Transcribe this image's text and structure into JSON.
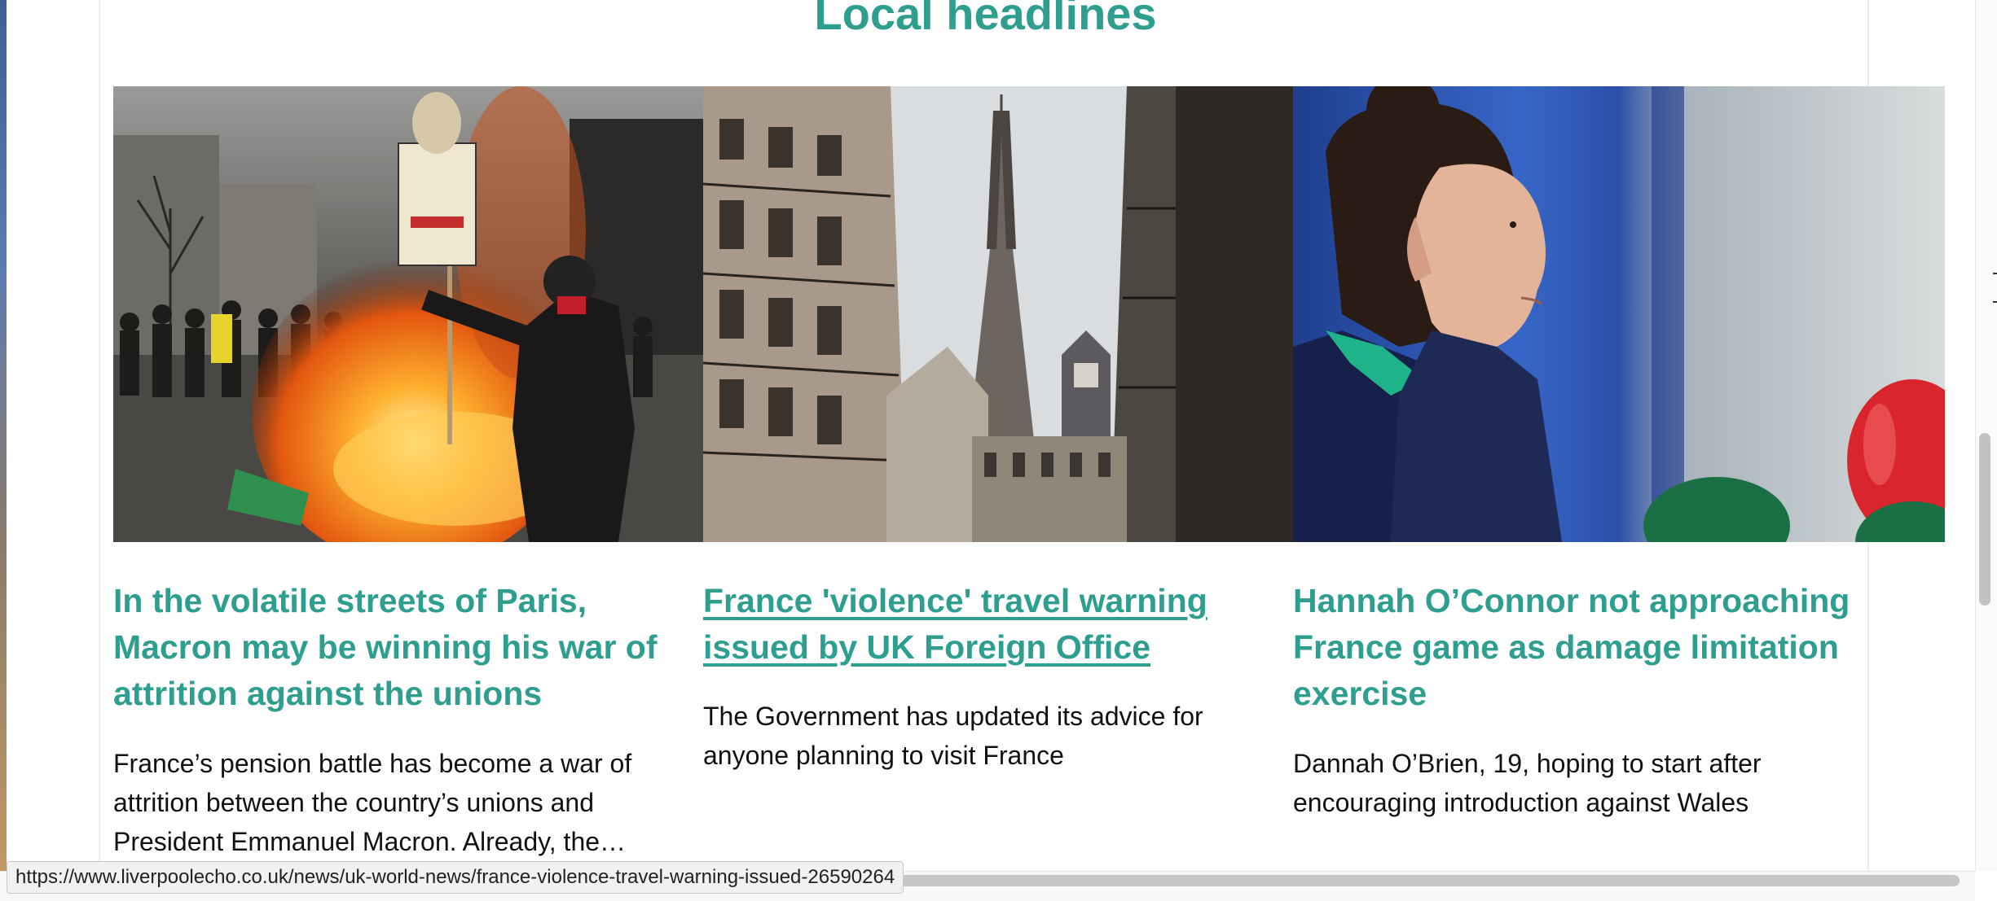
{
  "section": {
    "title": "Local headlines"
  },
  "cards": [
    {
      "image": "Protesters near a burning street fire in Paris, one holding a Macron placard",
      "headline": "In the volatile streets of Paris, Macron may be winning his war of attrition against the unions",
      "summary": "France’s pension battle has become a war of attrition between the country’s unions and President Emmanuel Macron. Already, the…"
    },
    {
      "image": "Parisian street view with Haussmann buildings and the Eiffel Tower",
      "headline": "France 'violence' travel warning issued by UK Foreign Office",
      "summary": "The Government has updated its advice for anyone planning to visit France"
    },
    {
      "image": "Ireland rugby player Hannah O’Connor speaking to press microphones",
      "headline": "Hannah O’Connor not approaching France game as damage limitation exercise",
      "summary": "Dannah O’Brien, 19, hoping to start after encouraging introduction against Wales"
    }
  ],
  "status_bar": {
    "url": "https://www.liverpoolecho.co.uk/news/uk-world-news/france-violence-travel-warning-issued-26590264"
  }
}
